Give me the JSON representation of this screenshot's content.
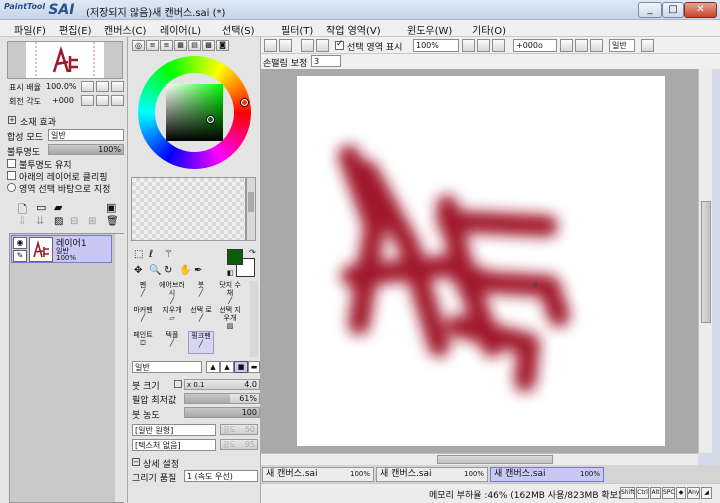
{
  "app": {
    "logo_small": "PaintTool",
    "logo_big": "SAI",
    "title": "(저장되지 않음)새 캔버스.sai (*)"
  },
  "window_buttons": {
    "minimize": "_",
    "maximize": "□",
    "close": "✕"
  },
  "menu": [
    "파일(F)",
    "편집(E)",
    "캔버스(C)",
    "레이어(L)",
    "선택(S)",
    "필터(T)",
    "작업 영역(V)",
    "윈도우(W)",
    "기타(O)"
  ],
  "navigator": {
    "zoom_label": "표시 배율",
    "zoom_value": "100.0%",
    "rotate_label": "회전 각도",
    "rotate_value": "+000"
  },
  "layer_props": {
    "effects_label": "소재 효과",
    "blend_label": "합성 모드",
    "blend_value": "일반",
    "opacity_label": "불투명도",
    "opacity_value": "100%",
    "opacity": 1.0,
    "preserve_opacity": "불투명도 유지",
    "clip_lower": "아래의 레이어로 클리핑",
    "selection_source": "영역 선택 바탕으로 지정"
  },
  "layers": [
    {
      "name": "레이어1",
      "mode": "일반",
      "opacity": "100%"
    }
  ],
  "colors": {
    "primary": "#0b5d0b",
    "secondary": "#ffffff",
    "accent": "#9a1020"
  },
  "tools": [
    [
      "펜",
      "에어브러시",
      "붓",
      "닷지\n수채"
    ],
    [
      "마커펜",
      "지우개",
      "선택\n로",
      "선택\n지우개"
    ],
    [
      "페인트",
      "텍플",
      "핑크펜",
      ""
    ]
  ],
  "tool_selected": "핑크펜",
  "brush": {
    "mode_value": "일반",
    "size_label": "붓 크기",
    "size_mult": "x 0.1",
    "size_value": "4.0",
    "minsize_label": "필압 최저값",
    "minsize_value": "61%",
    "minsize": 0.61,
    "density_label": "붓 농도",
    "density_value": "100",
    "density": 1.0,
    "shape_value": "[일반 원형]",
    "shape_strength": "강도",
    "shape_strength_value": "50",
    "texture_value": "[텍스처 없음]",
    "texture_strength": "강도",
    "texture_strength_value": "95",
    "detail_label": "상세 설정",
    "quality_label": "그리기 품질",
    "quality_value": "1 (속도 우선)"
  },
  "canvas_toolbar": {
    "selection_label": "선택 영역 표시",
    "zoom_value": "100%",
    "rotate_value": "+000o",
    "mode_value": "일반",
    "stabilizer_label": "손떨림 보정",
    "stabilizer_value": "3"
  },
  "tabs": [
    {
      "name": "새 캔버스.sai",
      "pct": "100%"
    },
    {
      "name": "새 캔버스.sai",
      "pct": "100%"
    },
    {
      "name": "새 캔버스.sai",
      "pct": "100%"
    }
  ],
  "status": {
    "memory": "메모리 부하율 :46% (162MB 사용/823MB 확보)",
    "keys": [
      "Shift",
      "Ctrl",
      "Alt",
      "SPC",
      "◆",
      "Any",
      "◢"
    ]
  }
}
